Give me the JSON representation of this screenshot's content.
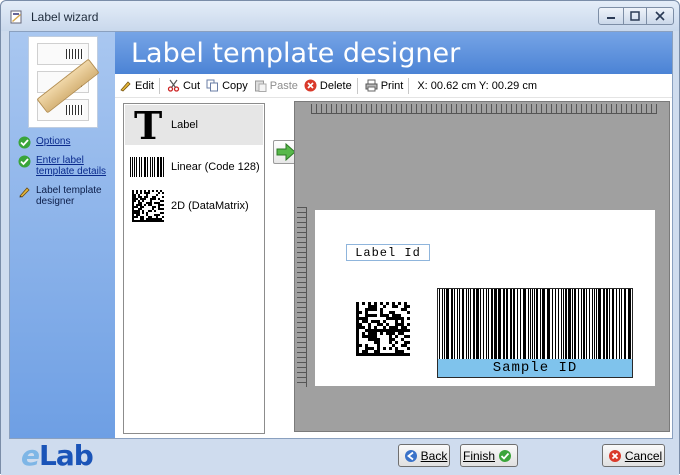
{
  "window": {
    "title": "Label wizard"
  },
  "header": {
    "title": "Label template designer"
  },
  "sidebar": {
    "steps": [
      {
        "label": "Options",
        "state": "done"
      },
      {
        "label": "Enter label template details",
        "state": "done"
      },
      {
        "label": "Label template designer",
        "state": "current"
      }
    ]
  },
  "toolbar": {
    "edit": "Edit",
    "cut": "Cut",
    "copy": "Copy",
    "paste": "Paste",
    "delete": "Delete",
    "print": "Print",
    "coords": "X: 00.62 cm Y: 00.29 cm"
  },
  "tools": [
    {
      "label": "Label",
      "icon": "text-T-icon",
      "selected": true
    },
    {
      "label": "Linear (Code 128)",
      "icon": "barcode-icon",
      "selected": false
    },
    {
      "label": "2D (DataMatrix)",
      "icon": "datamatrix-icon",
      "selected": false
    }
  ],
  "label_design": {
    "text_field": "Label Id",
    "barcode_text": "Sample ID"
  },
  "footer": {
    "logo_prefix": "e",
    "logo": "Lab",
    "back": "Back",
    "finish": "Finish",
    "cancel": "Cancel"
  },
  "colors": {
    "header": "#5a8fdc",
    "sidebar": "#8ab3ea",
    "barcode_text_bg": "#7fc3ec"
  }
}
